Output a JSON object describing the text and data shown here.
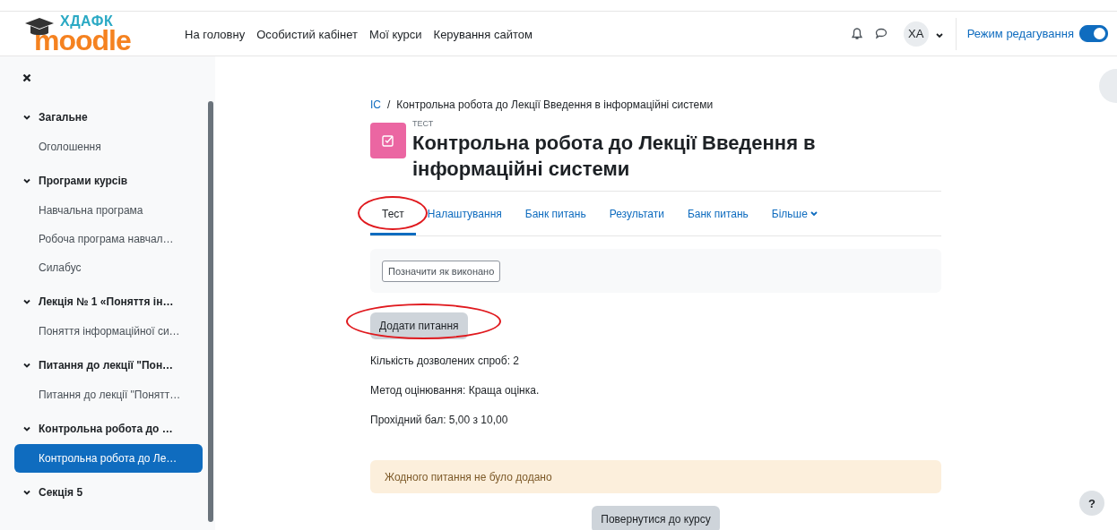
{
  "logo": {
    "top": "ХДАФК",
    "main": "moodle"
  },
  "nav": [
    {
      "label": "На головну"
    },
    {
      "label": "Особистий кабінет"
    },
    {
      "label": "Мої курси"
    },
    {
      "label": "Керування сайтом"
    }
  ],
  "user": {
    "initials": "ХА"
  },
  "edit_mode": {
    "label": "Режим редагування",
    "on": true
  },
  "sidebar": {
    "sections": [
      {
        "title": "Загальне",
        "expanded": true,
        "items": [
          {
            "label": "Оголошення",
            "selected": false
          }
        ]
      },
      {
        "title": "Програми курсів",
        "expanded": true,
        "items": [
          {
            "label": "Навчальна програма",
            "selected": false
          },
          {
            "label": "Робоча програма навчал…",
            "selected": false
          },
          {
            "label": "Силабус",
            "selected": false
          }
        ]
      },
      {
        "title": "Лекція № 1 «Поняття ін…",
        "expanded": true,
        "items": [
          {
            "label": "Поняття інформаційної си…",
            "selected": false
          }
        ]
      },
      {
        "title": "Питання до лекції \"Пон…",
        "expanded": true,
        "items": [
          {
            "label": "Питання до лекції \"Понятт…",
            "selected": false
          }
        ]
      },
      {
        "title": "Контрольна робота до …",
        "expanded": true,
        "items": [
          {
            "label": "Контрольна робота до Ле…",
            "selected": true
          }
        ]
      },
      {
        "title": "Секція 5",
        "expanded": true
      }
    ]
  },
  "breadcrumb": [
    {
      "label": "ІС",
      "link": true
    },
    {
      "label": "Контрольна робота до Лекції Введення в інформаційні системи",
      "link": false
    }
  ],
  "breadcrumb_separator": "/",
  "activity": {
    "type": "ТЕСТ",
    "title": "Контрольна робота до Лекції Введення в інформаційні системи"
  },
  "tabs": [
    {
      "label": "Тест",
      "selected": true,
      "circled": true,
      "dropdown": false
    },
    {
      "label": "Налаштування",
      "selected": false,
      "circled": false,
      "dropdown": false
    },
    {
      "label": "Банк питань",
      "selected": false,
      "circled": false,
      "dropdown": false
    },
    {
      "label": "Результати",
      "selected": false,
      "circled": false,
      "dropdown": false
    },
    {
      "label": "Банк питань",
      "selected": false,
      "circled": false,
      "dropdown": false
    },
    {
      "label": "Більше",
      "selected": false,
      "circled": false,
      "dropdown": true
    }
  ],
  "mark_done": "Позначити як виконано",
  "add_question": {
    "label": "Додати питання",
    "circled": true
  },
  "info": [
    "Кількість дозволених спроб: 2",
    "Метод оцінювання: Краща оцінка.",
    "Прохідний бал: 5,00 з 10,00"
  ],
  "notice": "Жодного питання не було додано",
  "back_button": "Повернутися до курсу",
  "help": "?"
}
